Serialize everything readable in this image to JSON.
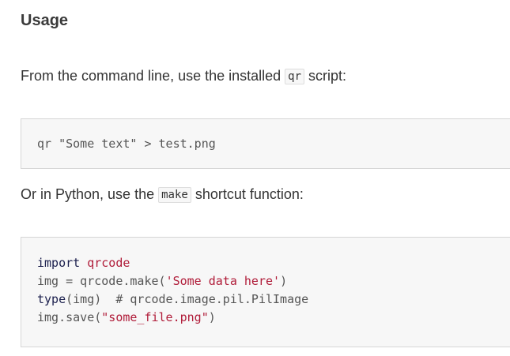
{
  "heading": "Usage",
  "para1": {
    "before": "From the command line, use the installed ",
    "code": "qr",
    "after": " script:"
  },
  "code_block1": {
    "line": "qr \"Some text\" > test.png"
  },
  "para2": {
    "before": "Or in Python, use the ",
    "code": "make",
    "after": " shortcut function:"
  },
  "code_block2": {
    "line1": {
      "kw": "import",
      "mod": "qrcode"
    },
    "line2": {
      "pre": "img = qrcode.make(",
      "str": "'Some data here'",
      "post": ")"
    },
    "line3": {
      "kw": "type",
      "mid": "(img)  ",
      "comment": "# qrcode.image.pil.PilImage"
    },
    "line4": {
      "pre": "img.save(",
      "str": "\"some_file.png\"",
      "post": ")"
    }
  },
  "colors": {
    "keyword": "#1b1f4d",
    "string": "#b01c39",
    "code_background": "#f7f7f7",
    "text": "#333333"
  }
}
